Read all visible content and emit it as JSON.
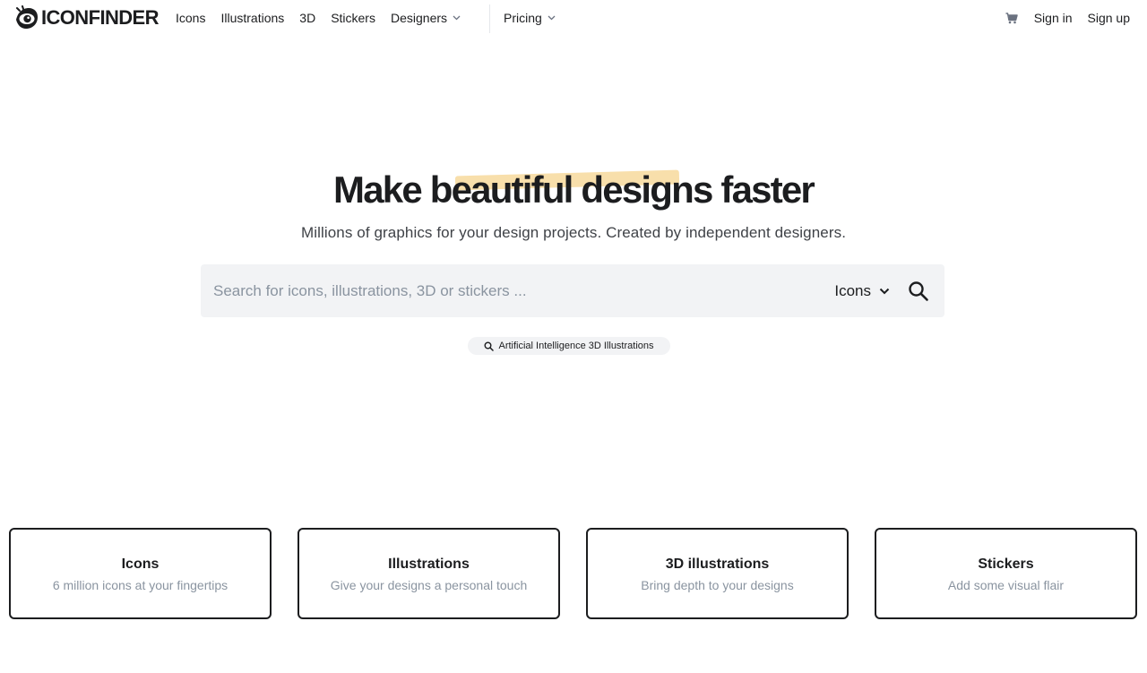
{
  "brand": {
    "name": "ICONFINDER"
  },
  "nav": {
    "items": [
      {
        "label": "Icons"
      },
      {
        "label": "Illustrations"
      },
      {
        "label": "3D"
      },
      {
        "label": "Stickers"
      },
      {
        "label": "Designers",
        "icon": "chevron-down-icon"
      }
    ],
    "pricing": {
      "label": "Pricing",
      "icon": "chevron-down-icon"
    },
    "cart_icon": "cart-icon",
    "sign_in": "Sign in",
    "sign_up": "Sign up"
  },
  "hero": {
    "title": "Make beautiful designs faster",
    "subtitle": "Millions of graphics for your design projects. Created by independent designers.",
    "highlight_color": "#f7dca2"
  },
  "search": {
    "placeholder": "Search for icons, illustrations, 3D or stickers ...",
    "value": "",
    "type_selected": "Icons",
    "search_icon": "search-icon"
  },
  "suggestion": {
    "label": "Artificial Intelligence 3D Illustrations",
    "icon": "search-icon"
  },
  "categories": [
    {
      "title": "Icons",
      "description": "6 million icons at your fingertips"
    },
    {
      "title": "Illustrations",
      "description": "Give your designs a personal touch"
    },
    {
      "title": "3D illustrations",
      "description": "Bring depth to your designs"
    },
    {
      "title": "Stickers",
      "description": "Add some visual flair"
    }
  ],
  "colors": {
    "text": "#1c1d1f",
    "muted": "#8a94a0",
    "search_bg": "#f2f3f5"
  }
}
